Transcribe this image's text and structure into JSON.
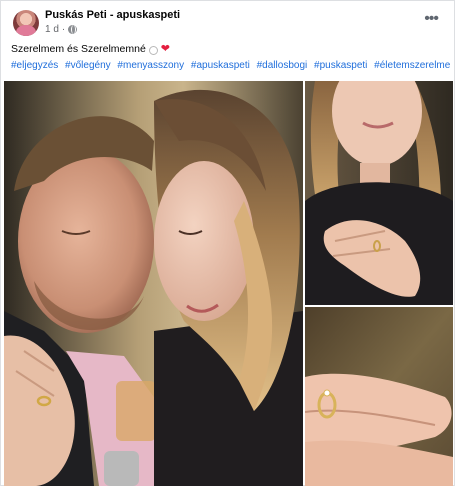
{
  "post": {
    "author": "Puskás Peti - apuskaspeti",
    "time": "1 d",
    "more_label": "•••",
    "caption": "Szerelmem és Szerelmemné",
    "hashtags": [
      "#eljegyzés",
      "#vőlegény",
      "#menyasszony",
      "#apuskaspeti",
      "#dallosbogi",
      "#puskaspeti",
      "#életemszerelme"
    ]
  },
  "icons": {
    "avatar": "profile-avatar",
    "privacy": "globe-icon",
    "more": "more-options-icon",
    "ring": "ring-emoji",
    "heart": "red-heart-emoji"
  },
  "colors": {
    "link": "#216fdb",
    "text": "#050505",
    "meta": "#65676b",
    "heart": "#e41e3f"
  }
}
